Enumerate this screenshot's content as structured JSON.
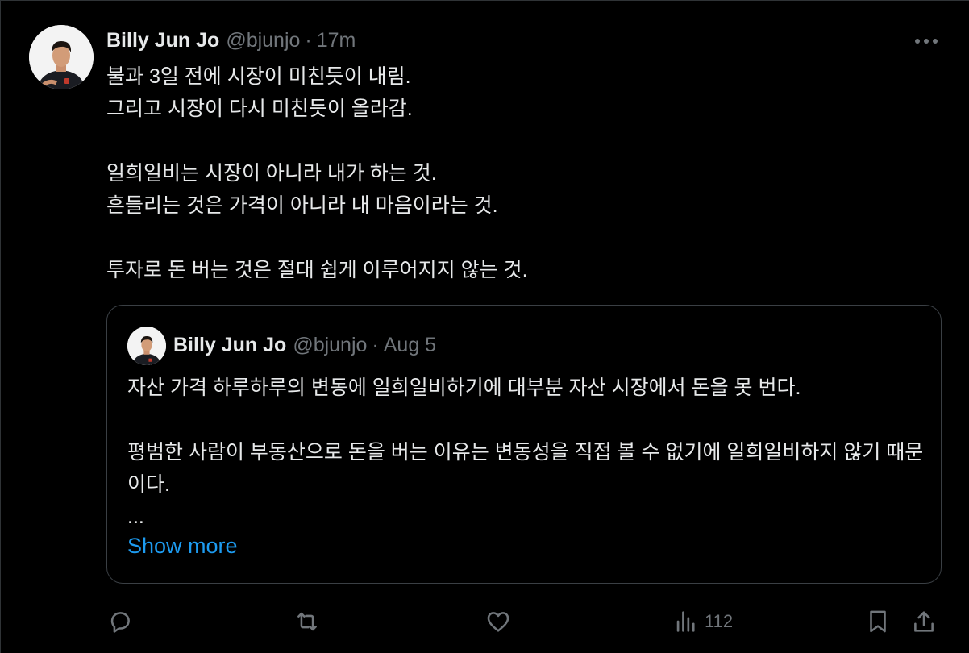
{
  "tweet": {
    "author_name": "Billy Jun Jo",
    "handle": "@bjunjo",
    "separator": "·",
    "time": "17m",
    "lines": [
      "불과 3일 전에 시장이 미친듯이 내림.",
      "그리고 시장이 다시 미친듯이 올라감.",
      "일희일비는 시장이 아니라 내가 하는 것.",
      "흔들리는 것은 가격이 아니라 내 마음이라는 것.",
      "투자로 돈 버는 것은 절대 쉽게 이루어지지 않는 것."
    ],
    "more_icon": "more-horizontal-icon"
  },
  "quote": {
    "author_name": "Billy Jun Jo",
    "handle": "@bjunjo",
    "separator": "·",
    "date": "Aug 5",
    "lines": [
      "자산 가격 하루하루의 변동에 일희일비하기에 대부분 자산 시장에서 돈을 못 번다.",
      "평범한 사람이 부동산으로 돈을 버는 이유는 변동성을 직접 볼 수 없기에 일희일비하지 않기 때문이다.",
      "..."
    ],
    "show_more": "Show more"
  },
  "actions": {
    "reply_icon": "reply-icon",
    "retweet_icon": "retweet-icon",
    "like_icon": "heart-icon",
    "views_icon": "views-chart-icon",
    "views_count": "112",
    "bookmark_icon": "bookmark-icon",
    "share_icon": "share-icon"
  },
  "colors": {
    "background": "#000000",
    "text": "#e7e9ea",
    "secondary": "#71767b",
    "link": "#1d9bf0",
    "border": "#3a3f44"
  }
}
